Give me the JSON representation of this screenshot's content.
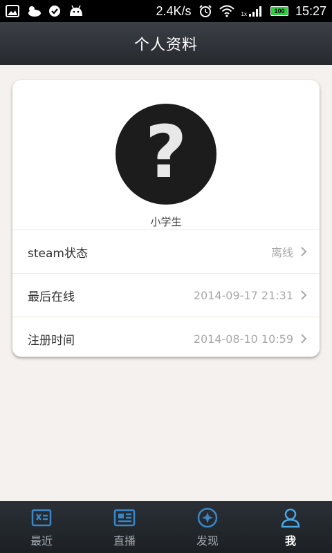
{
  "status_bar": {
    "net_speed": "2.4K/s",
    "signal_badge": "1x",
    "battery": "100",
    "time": "15:27"
  },
  "header": {
    "title": "个人资料"
  },
  "profile": {
    "avatar_icon": "question-mark-avatar",
    "avatar_glyph": "?",
    "nickname": "小学生",
    "rows": [
      {
        "label": "steam状态",
        "value": "离线"
      },
      {
        "label": "最后在线",
        "value": "2014-09-17 21:31"
      },
      {
        "label": "注册时间",
        "value": "2014-08-10 10:59"
      }
    ]
  },
  "bottom_nav": {
    "items": [
      {
        "label": "最近",
        "icon": "recent-icon"
      },
      {
        "label": "直播",
        "icon": "live-icon"
      },
      {
        "label": "发现",
        "icon": "compass-icon"
      },
      {
        "label": "我",
        "icon": "user-icon",
        "active": true
      }
    ]
  },
  "colors": {
    "nav_icon": "#3a87c8",
    "nav_active_icon": "#4aa8e6",
    "background": "#f4f1ee"
  }
}
